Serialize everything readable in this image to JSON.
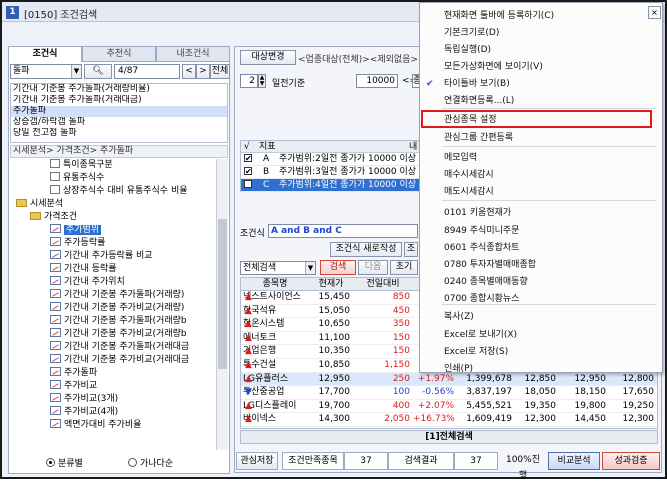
{
  "window": {
    "number": "1",
    "title": "[0150] 조건검색"
  },
  "left": {
    "tabs": [
      "조건식",
      "추천식",
      "내조건식"
    ],
    "combo": "돌파",
    "counter": "4/87",
    "all_btn": "전체",
    "list": [
      "기간내 기준봉 주가돌파(거래량비율)",
      "기간내 기준봉 주가돌파(거래대금)",
      "주가돌파",
      "상승갭/하락갭 돌파",
      "당일 전고점 돌파"
    ],
    "path": "시세분석> 가격조건> 주가돌파",
    "tree": [
      {
        "t": "특이종목구분",
        "lv": 2,
        "ic": "item"
      },
      {
        "t": "유통주식수",
        "lv": 2,
        "ic": "item"
      },
      {
        "t": "상장주식수 대비 유통주식수 비율",
        "lv": 2,
        "ic": "item"
      },
      {
        "t": "시세분석",
        "lv": 0,
        "ic": "folder"
      },
      {
        "t": "가격조건",
        "lv": 1,
        "ic": "folder"
      },
      {
        "t": "주가범위",
        "lv": 2,
        "ic": "chart",
        "sel": true
      },
      {
        "t": "주가등락률",
        "lv": 2,
        "ic": "chart"
      },
      {
        "t": "기간내 주가등락률 비교",
        "lv": 2,
        "ic": "chart"
      },
      {
        "t": "기간내 등락률",
        "lv": 2,
        "ic": "chart"
      },
      {
        "t": "기간내 주가위치",
        "lv": 2,
        "ic": "chart"
      },
      {
        "t": "기간내 기준봉 주가돌파(거래량)",
        "lv": 2,
        "ic": "chart"
      },
      {
        "t": "기간내 기준봉 주가비교(거래량)",
        "lv": 2,
        "ic": "chart"
      },
      {
        "t": "기간내 기준봉 주가돌파(거래량b",
        "lv": 2,
        "ic": "chart"
      },
      {
        "t": "기간내 기준봉 주가비교(거래량b",
        "lv": 2,
        "ic": "chart"
      },
      {
        "t": "기간내 기준봉 주가돌파(거래대금",
        "lv": 2,
        "ic": "chart"
      },
      {
        "t": "기간내 기준봉 주가비교(거래대금",
        "lv": 2,
        "ic": "chart"
      },
      {
        "t": "주가돌파",
        "lv": 2,
        "ic": "chart"
      },
      {
        "t": "주가비교",
        "lv": 2,
        "ic": "chart"
      },
      {
        "t": "주가비교(3개)",
        "lv": 2,
        "ic": "chart"
      },
      {
        "t": "주가비교(4개)",
        "lv": 2,
        "ic": "chart"
      },
      {
        "t": "액면가대비 주가비율",
        "lv": 2,
        "ic": "chart"
      }
    ],
    "radio1": "분류별",
    "radio2": "가나다순"
  },
  "right": {
    "target_btn": "대상변경",
    "target_text": "<업종대상(전체)><제외없음>",
    "spin_val": "2",
    "spin_label": "일전기준",
    "val_input": "10000",
    "lte": "<=",
    "cut": "종가",
    "cond_hdr_chk": "√",
    "cond_hdr_idx": "지표",
    "cond_hdr_content": "내",
    "conds": [
      {
        "i": "A",
        "t": "주가범위:2일전 종가가 10000 이상"
      },
      {
        "i": "B",
        "t": "주가범위:3일전 종가가 10000 이상"
      },
      {
        "i": "C",
        "t": "주가범위:4일전 종가가 10000 이상"
      }
    ],
    "formula_label": "조건식",
    "formula": "A and B and C",
    "new_btn": "조건식 새로작성",
    "cond_btn2": "조",
    "search_combo": "전체검색",
    "search_btn": "검색",
    "next_btn": "다음",
    "init_btn": "초기",
    "cols": [
      "종목명",
      "현재가",
      "전일대비",
      "",
      "",
      "",
      "",
      ""
    ],
    "rows": [
      {
        "n": "넥스트사이언스",
        "p": "15,450",
        "d": "850",
        "dir": "up",
        "r": "",
        "a": "",
        "b": "",
        "c": ""
      },
      {
        "n": "한국석유",
        "p": "15,050",
        "d": "450",
        "dir": "up",
        "r": "",
        "a": "",
        "b": "",
        "c": ""
      },
      {
        "n": "한온시스템",
        "p": "10,650",
        "d": "350",
        "dir": "up",
        "r": "",
        "a": "",
        "b": "",
        "c": ""
      },
      {
        "n": "에너토크",
        "p": "11,100",
        "d": "150",
        "dir": "up",
        "r": "",
        "a": "",
        "b": "",
        "c": ""
      },
      {
        "n": "기업은행",
        "p": "10,350",
        "d": "150",
        "dir": "up",
        "r": "",
        "a": "",
        "b": "",
        "c": ""
      },
      {
        "n": "특수건설",
        "p": "10,850",
        "d": "1,150",
        "dir": "up",
        "r": "",
        "a": "",
        "b": "",
        "c": ""
      },
      {
        "n": "LG유플러스",
        "p": "12,950",
        "d": "250",
        "dir": "up",
        "r": "+1.97%",
        "a": "1,399,678",
        "b": "12,850",
        "c": "12,950",
        "e": "12,800",
        "sel": true
      },
      {
        "n": "두산중공업",
        "p": "17,700",
        "d": "100",
        "dir": "dn",
        "r": "-0.56%",
        "a": "3,837,197",
        "b": "18,050",
        "c": "18,150",
        "e": "17,650"
      },
      {
        "n": "LG디스플레이",
        "p": "19,700",
        "d": "400",
        "dir": "up",
        "r": "+2.07%",
        "a": "5,455,521",
        "b": "19,350",
        "c": "19,800",
        "e": "19,250"
      },
      {
        "n": "바이넥스",
        "p": "14,300",
        "d": "2,050",
        "dir": "up",
        "r": "+16.73%",
        "a": "1,609,419",
        "b": "12,300",
        "c": "14,450",
        "e": "12,300"
      }
    ],
    "grid_footer": "[1]전체검색",
    "save_btn": "관심저장",
    "count_label": "조건만족종목",
    "count_val": "37",
    "result_label": "검색결과",
    "result_val": "37",
    "progress": "100%진행",
    "anal_btn": "비교분석",
    "verify_btn": "성과검증"
  },
  "menu": {
    "items": [
      "현재화면 툴바에 등록하기(C)",
      "기본크기로(D)",
      "독립실행(D)",
      "모든가상화면에 보이기(V)",
      "타이틀바 보기(B)",
      "연결화면등록...(L)",
      "관심종목 설정",
      "관심그룹 간편등록",
      "메모입력",
      "매수시세감시",
      "매도시세감시",
      "0101 키움현재가",
      "8949 주식미니주문",
      "0601 주식종합차트",
      "0780 투자자별매매종합",
      "0240 종목별매매동향",
      "0700 종합시황뉴스",
      "복사(Z)",
      "Excel로 보내기(X)",
      "Excel로 저장(S)",
      "인쇄(P)"
    ],
    "checked_item": "✔"
  }
}
